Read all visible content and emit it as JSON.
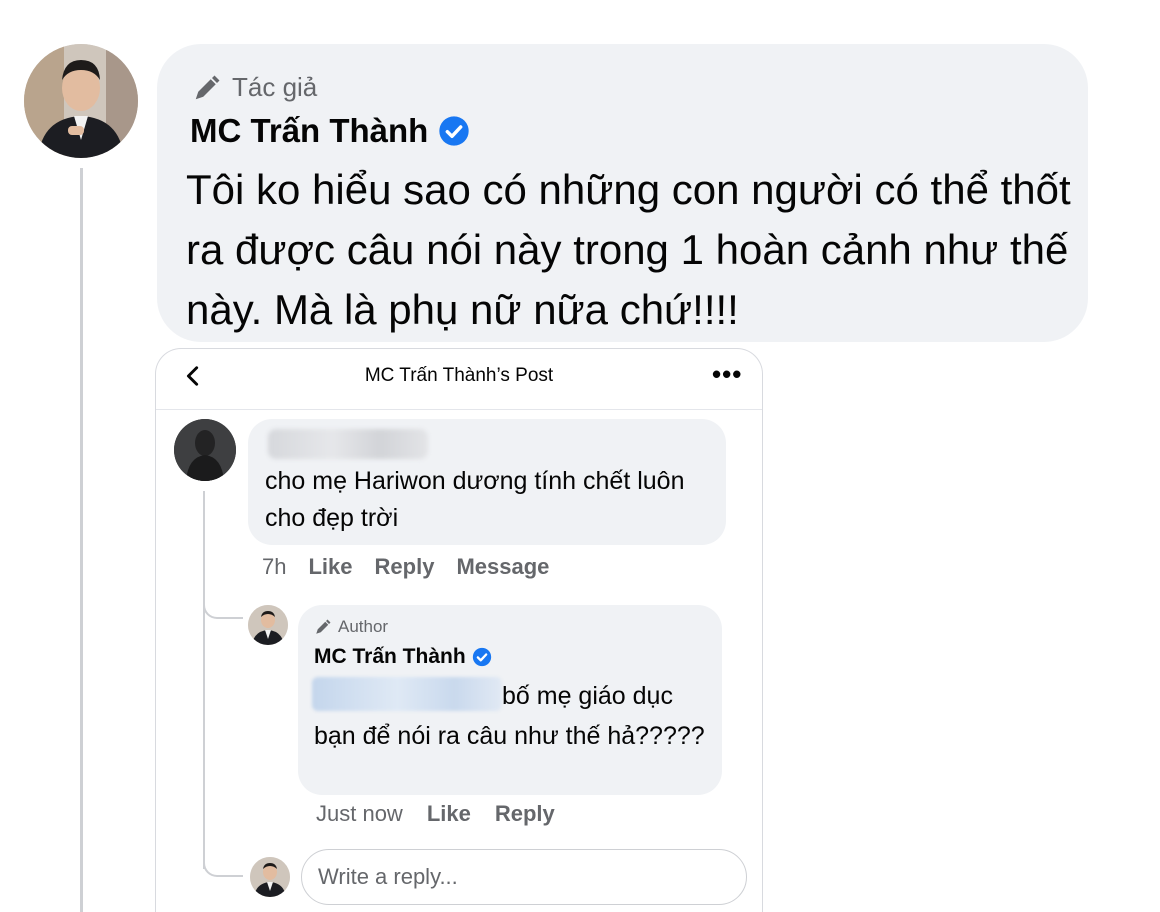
{
  "post_comment": {
    "author_badge": "Tác giả",
    "author_name": "MC Trấn Thành",
    "text": "Tôi ko hiểu sao có những con người có thể thốt ra được câu nói này trong 1 hoàn cảnh như thế này. Mà là phụ nữ nữa chứ!!!!"
  },
  "screenshot": {
    "header_title": "MC Trấn Thành’s Post",
    "more_label": "•••",
    "comment": {
      "text": "cho mẹ Hariwon dương tính chết luôn cho đẹp trời",
      "time": "7h",
      "like": "Like",
      "reply": "Reply",
      "message": "Message"
    },
    "reply": {
      "author_badge": "Author",
      "author_name": "MC Trấn Thành",
      "text": "bố mẹ giáo dục bạn để nói ra câu như thế hả?????",
      "time": "Just now",
      "like": "Like",
      "reply": "Reply"
    },
    "reply_input": {
      "placeholder": "Write a reply..."
    }
  },
  "colors": {
    "bubble": "#f0f2f5",
    "secondary_text": "#65676b",
    "verified": "#1877f2",
    "thread_line": "#ced0d4"
  },
  "icons": [
    "pen-icon",
    "verified-badge-icon",
    "back-chevron-icon",
    "more-options-icon"
  ]
}
